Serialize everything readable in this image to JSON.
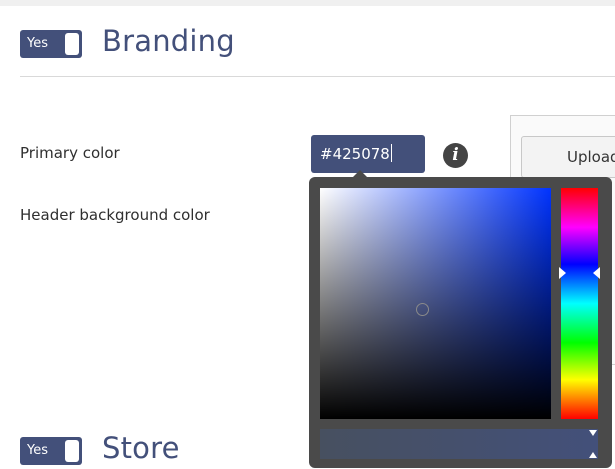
{
  "branding": {
    "toggle_label": "Yes",
    "title": "Branding",
    "primary_color_label": "Primary color",
    "primary_color_value": "#425078",
    "header_bg_label": "Header background color",
    "upload_button": "Upload"
  },
  "store": {
    "toggle_label": "Yes",
    "title": "Store"
  },
  "colors": {
    "accent": "#43507a",
    "picker_bg": "#4a4a4a"
  }
}
